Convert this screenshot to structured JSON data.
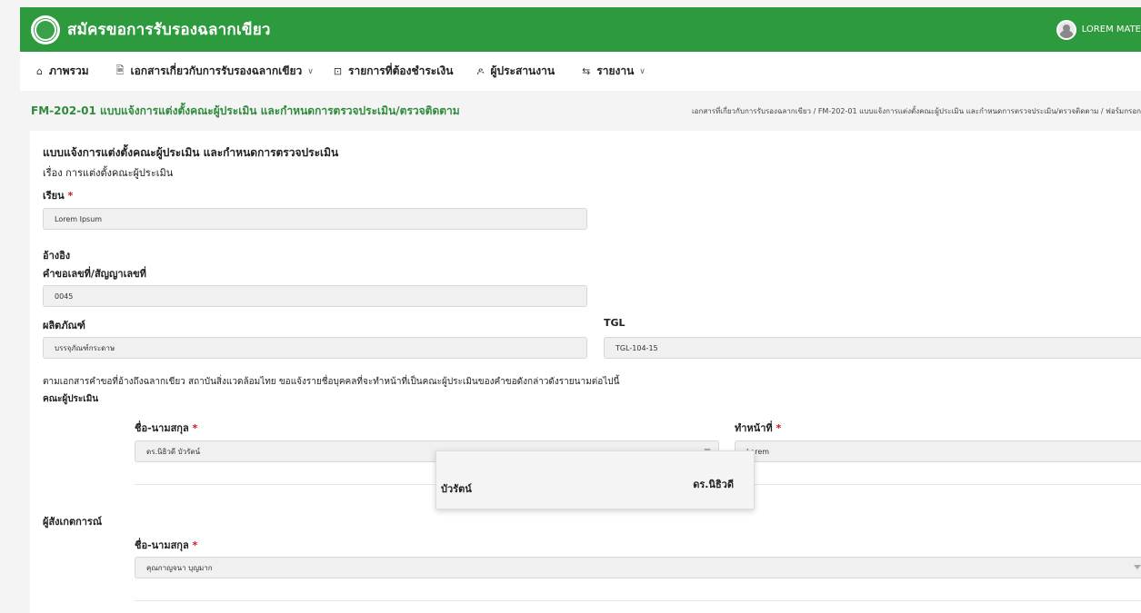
{
  "header": {
    "app_title": "สมัครขอการรับรองฉลากเขียว",
    "user_name": "LOREM MATE"
  },
  "nav": {
    "items": [
      {
        "icon": "home-icon",
        "label": "ภาพรวม"
      },
      {
        "icon": "document-icon",
        "label": "เอกสารเกี่ยวกับการรับรองฉลากเขียว"
      },
      {
        "icon": "payment-icon",
        "label": "รายการที่ต้องชำระเงิน"
      },
      {
        "icon": "user-icon",
        "label": "ผู้ประสานงาน"
      },
      {
        "icon": "report-icon",
        "label": "รายงาน"
      }
    ]
  },
  "page": {
    "title": "FM-202-01 แบบแจ้งการแต่งตั้งคณะผู้ประเมิน และกำหนดการตรวจประเมิน/ตรวจติดตาม",
    "breadcrumb": "เอกสารที่เกี่ยวกับการรับรองฉลากเขียว / FM-202-01 แบบแจ้งการแต่งตั้งคณะผู้ประเมิน และกำหนดการตรวจประเมิน/ตรวจติดตาม / ฟอร์มกรอก"
  },
  "form": {
    "heading": "แบบแจ้งการแต่งตั้งคณะผู้ประเมิน และกำหนดการตรวจประเมิน",
    "subject": "เรื่อง การแต่งตั้งคณะผู้ประเมิน",
    "to_label": "เรียน",
    "required_mark": "*",
    "to_value": "Lorem Ipsum",
    "ref_label": "อ้างอิง",
    "request_no_label": "คำขอเลขที่/สัญญาเลขที่",
    "request_no_value": "0045",
    "product_label": "ผลิตภัณฑ์",
    "product_value": "บรรจุภัณฑ์กระดาษ",
    "tgl_label": "TGL",
    "tgl_value": "TGL-104-15",
    "notice": "ตามเอกสารคำขอที่อ้างถึงฉลากเขียว สถาบันสิ่งแวดล้อมไทย ขอแจ้งรายชื่อบุคคลที่จะทำหน้าที่เป็นคณะผู้ประเมินของคำขอดังกล่าวดังรายนามต่อไปนี้",
    "assessors_label": "คณะผู้ประเมิน",
    "name_label": "ชื่อ-นามสกุล",
    "assessor_name_value": "ดร.นิธิวดี บัวรัตน์",
    "role_label": "ทำหน้าที่",
    "role_value": "Lorem",
    "observer_label": "ผู้สังเกตการณ์",
    "observer_name_value": "คุณกาญจนา บุญมาก"
  },
  "dropdown": {
    "line1": "ดร.นิธิวดี",
    "line2": "บัวรัตน์"
  }
}
